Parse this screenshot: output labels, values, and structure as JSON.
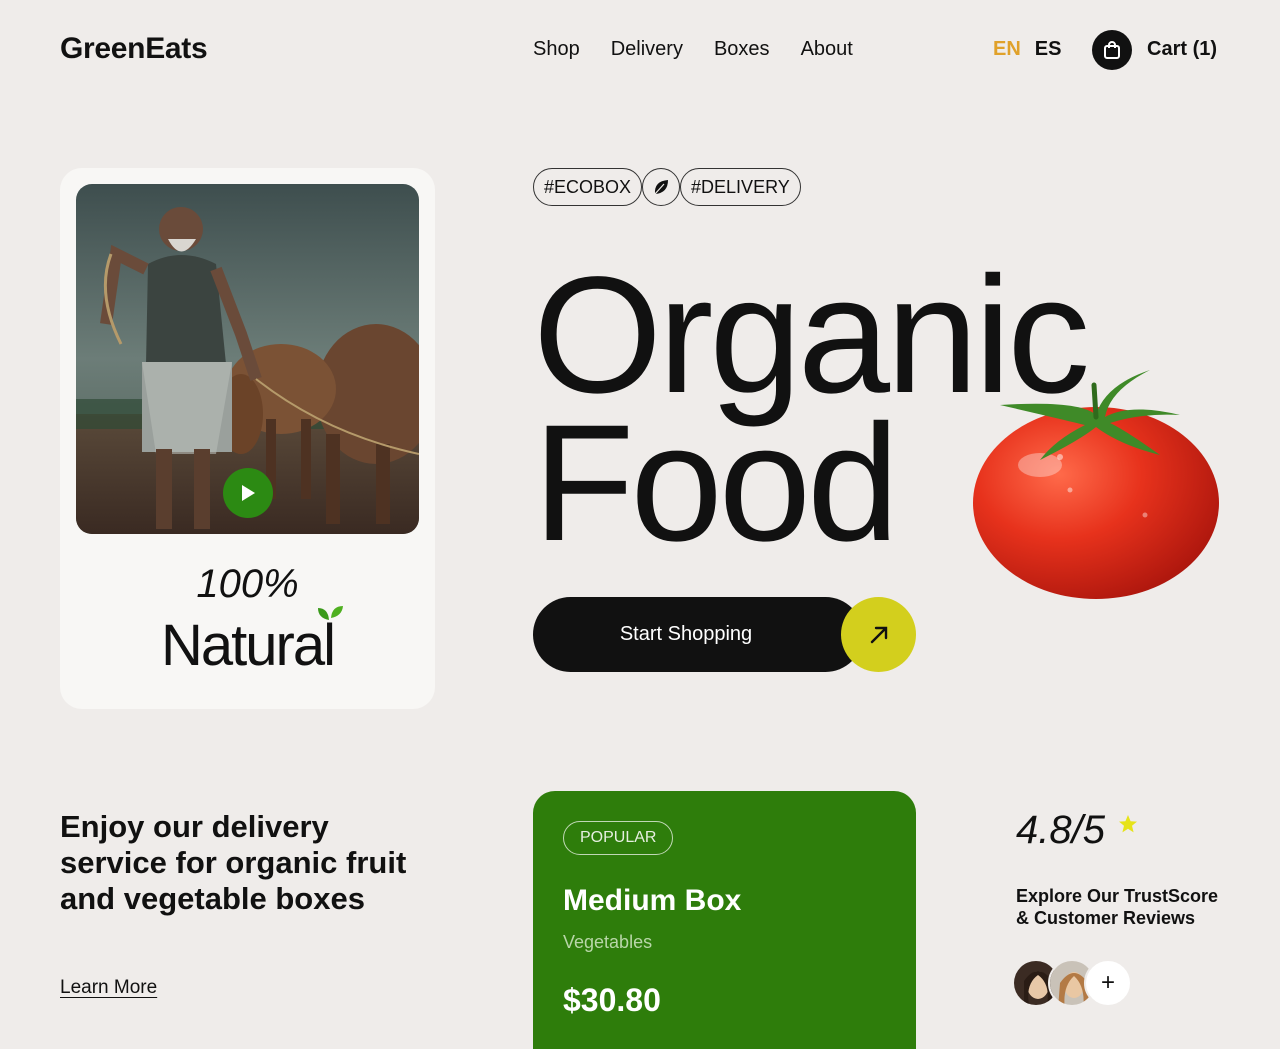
{
  "header": {
    "logo": "GreenEats",
    "nav": [
      "Shop",
      "Delivery",
      "Boxes",
      "About"
    ],
    "lang_en": "EN",
    "lang_es": "ES",
    "cart_label": "Cart (1)"
  },
  "hero": {
    "tags": [
      "#ECOBOX",
      "#DELIVERY"
    ],
    "headline_line1": "Organic",
    "headline_line2": "Food",
    "cta_label": "Start Shopping",
    "card_percent": "100%",
    "card_word": "Natural"
  },
  "promo": {
    "text": "Enjoy our delivery service for organic fruit and vegetable boxes",
    "link": "Learn More"
  },
  "box": {
    "badge": "POPULAR",
    "name": "Medium Box",
    "category": "Vegetables",
    "price": "$30.80"
  },
  "rating": {
    "score": "4.8/5",
    "text": "Explore Our TrustScore & Customer Reviews",
    "more": "+"
  },
  "colors": {
    "accent_green": "#2e7d0b",
    "accent_yellow": "#d3cf1d",
    "lang_active": "#e0a12a"
  }
}
